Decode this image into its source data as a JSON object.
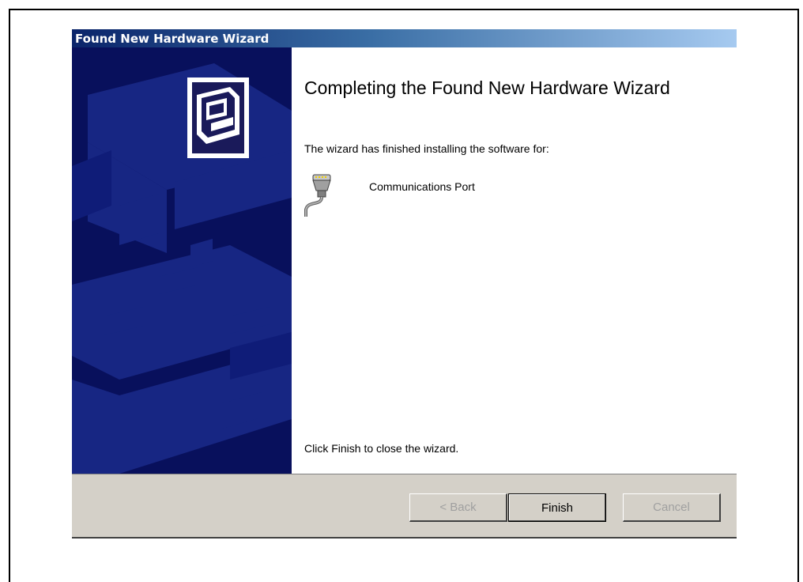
{
  "window": {
    "title": "Found New Hardware Wizard"
  },
  "content": {
    "heading": "Completing the Found New Hardware Wizard",
    "intro": "The wizard has finished installing the software for:",
    "device": {
      "icon": "serial-port-icon",
      "label": "Communications Port"
    },
    "footer": "Click Finish to close the wizard."
  },
  "buttons": {
    "back": "< Back",
    "finish": "Finish",
    "cancel": "Cancel"
  },
  "colors": {
    "sidebar_bg": "#08105c",
    "titlebar_start": "#0a246a",
    "titlebar_end": "#a6caf0",
    "button_face": "#d4d0c8"
  }
}
